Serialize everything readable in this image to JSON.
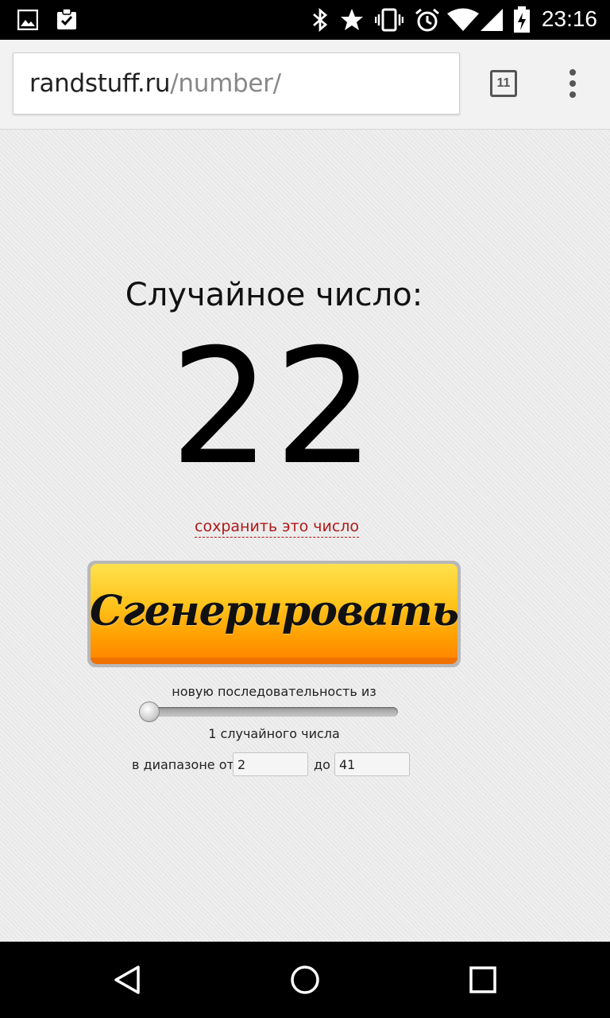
{
  "status_bar": {
    "time": "23:16",
    "icons": [
      "image-icon",
      "clipboard-check-icon",
      "bluetooth-icon",
      "star-icon",
      "vibrate-icon",
      "alarm-icon",
      "wifi-icon",
      "signal-icon",
      "battery-icon"
    ]
  },
  "browser": {
    "url_domain": "randstuff.ru",
    "url_path": "/number/",
    "tab_count": "11"
  },
  "page": {
    "title": "Случайное число:",
    "number": "22",
    "save_link": "сохранить это число",
    "generate_button": "Сгенерировать",
    "sequence_label": "новую последовательность из",
    "count_label": "1 случайного числа",
    "range_from_label": "в диапазоне от",
    "range_from_value": "2",
    "range_to_label": "до",
    "range_to_value": "41"
  },
  "colors": {
    "link": "#b01818",
    "button_top": "#ffe24d",
    "button_bottom": "#ff8800"
  }
}
